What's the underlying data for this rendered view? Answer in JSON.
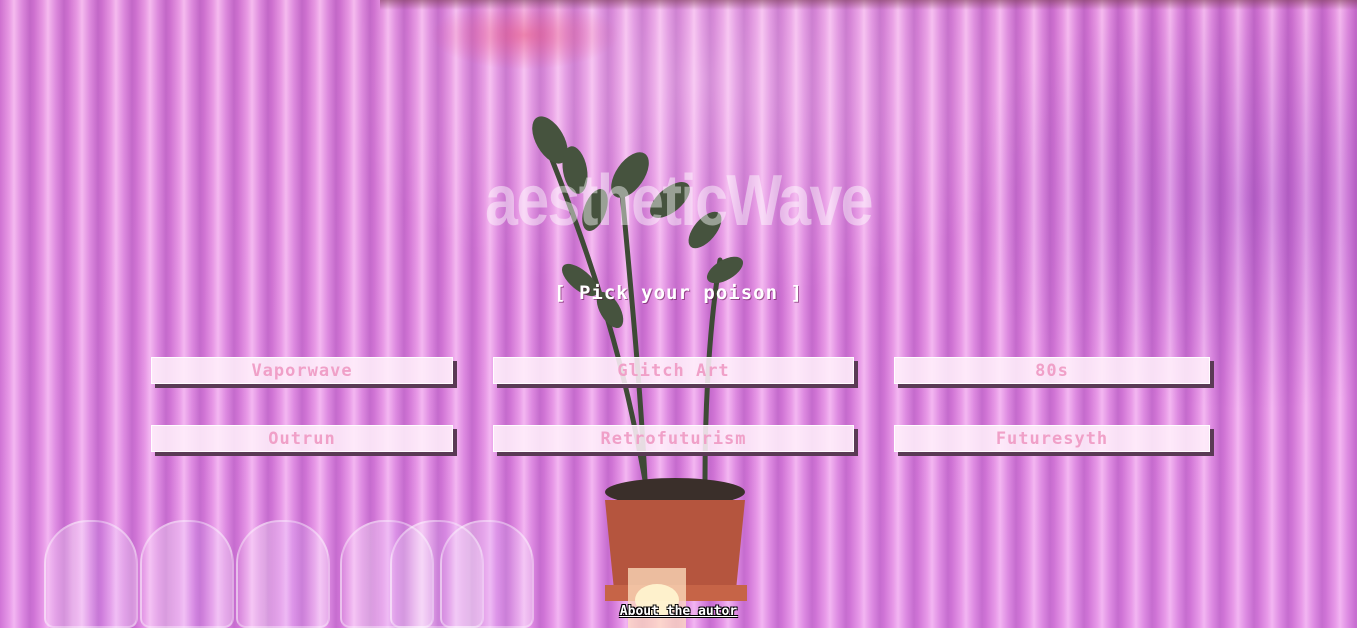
{
  "header": {
    "title": "aestheticWave",
    "subtitle": "[ Pick your poison ]"
  },
  "categories": [
    {
      "label": "Vaporwave"
    },
    {
      "label": "Glitch Art"
    },
    {
      "label": "80s"
    },
    {
      "label": "Outrun"
    },
    {
      "label": "Retrofuturism"
    },
    {
      "label": "Futuresyth"
    }
  ],
  "footer": {
    "about_link": "About the autor"
  },
  "colors": {
    "button_text": "#f0a0c8",
    "button_bg": "#fff0fa",
    "button_shadow": "#5a3a55",
    "background_pink": "#d77fd6"
  }
}
